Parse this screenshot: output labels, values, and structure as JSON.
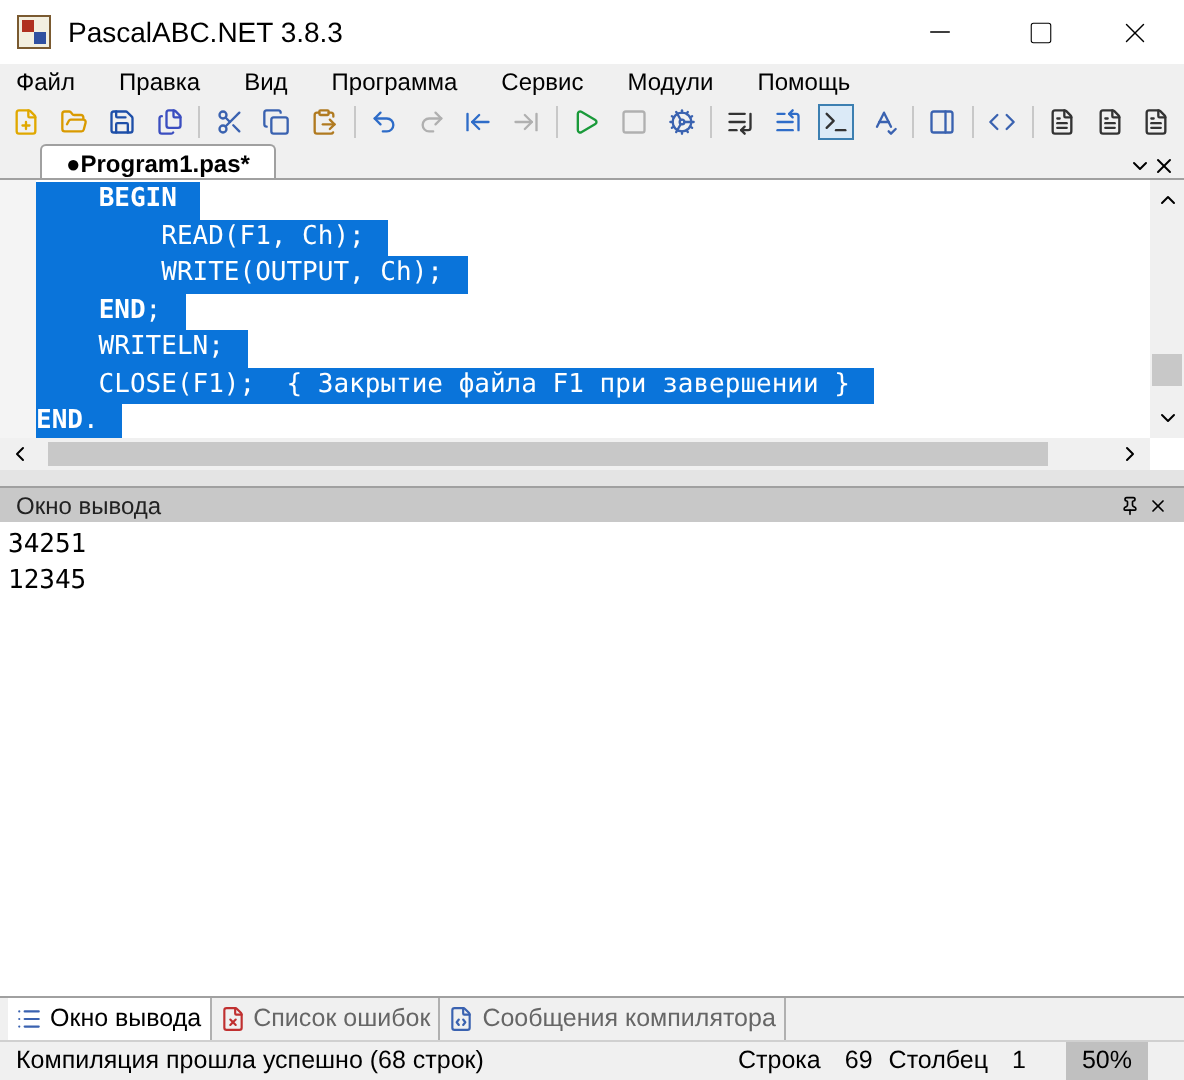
{
  "window": {
    "title": "PascalABC.NET 3.8.3"
  },
  "menu": [
    "Файл",
    "Правка",
    "Вид",
    "Программа",
    "Сервис",
    "Модули",
    "Помощь"
  ],
  "toolbar": [
    {
      "kind": "new"
    },
    {
      "kind": "open"
    },
    {
      "kind": "save"
    },
    {
      "kind": "saveall"
    },
    {
      "kind": "sep"
    },
    {
      "kind": "cut"
    },
    {
      "kind": "copy"
    },
    {
      "kind": "paste"
    },
    {
      "kind": "sep"
    },
    {
      "kind": "undo",
      "disabled": false
    },
    {
      "kind": "redo",
      "disabled": true
    },
    {
      "kind": "back",
      "disabled": false
    },
    {
      "kind": "forward",
      "disabled": true
    },
    {
      "kind": "sep"
    },
    {
      "kind": "run",
      "disabled": false
    },
    {
      "kind": "stop",
      "disabled": true
    },
    {
      "kind": "compile"
    },
    {
      "kind": "sep"
    },
    {
      "kind": "step"
    },
    {
      "kind": "stepover"
    },
    {
      "kind": "console",
      "selected": true
    },
    {
      "kind": "format"
    },
    {
      "kind": "sep"
    },
    {
      "kind": "panel"
    },
    {
      "kind": "sep"
    },
    {
      "kind": "code"
    },
    {
      "kind": "sep"
    },
    {
      "kind": "docD"
    },
    {
      "kind": "docL"
    },
    {
      "kind": "docR"
    }
  ],
  "editor_tabs": [
    {
      "label": "●Program1.pas*",
      "selected": true
    }
  ],
  "code_lines": [
    {
      "text": "    **BEGIN**",
      "selected": true
    },
    {
      "text": "        READ(F1, Ch);",
      "selected": true
    },
    {
      "text": "        WRITE(OUTPUT, Ch);",
      "selected": true
    },
    {
      "text": "    **END**;",
      "selected": true
    },
    {
      "text": "    WRITELN;",
      "selected": true
    },
    {
      "text": "    CLOSE(F1);  { Закрытие файла F1 при завершении }",
      "selected": true
    },
    {
      "text": "**END**.",
      "selected": true
    }
  ],
  "output_panel": {
    "title": "Окно вывода",
    "lines": [
      "34251",
      "12345"
    ]
  },
  "bottom_tabs": [
    {
      "label": "Окно вывода",
      "selected": true,
      "kind": "output"
    },
    {
      "label": "Список ошибок",
      "selected": false,
      "kind": "errors"
    },
    {
      "label": "Сообщения компилятора",
      "selected": false,
      "kind": "messages"
    }
  ],
  "status_bar": {
    "message": "Компиляция прошла успешно (68 строк)",
    "line_label": "Строка",
    "line": "69",
    "col_label": "Столбец",
    "col": "1",
    "zoom": "50%"
  }
}
